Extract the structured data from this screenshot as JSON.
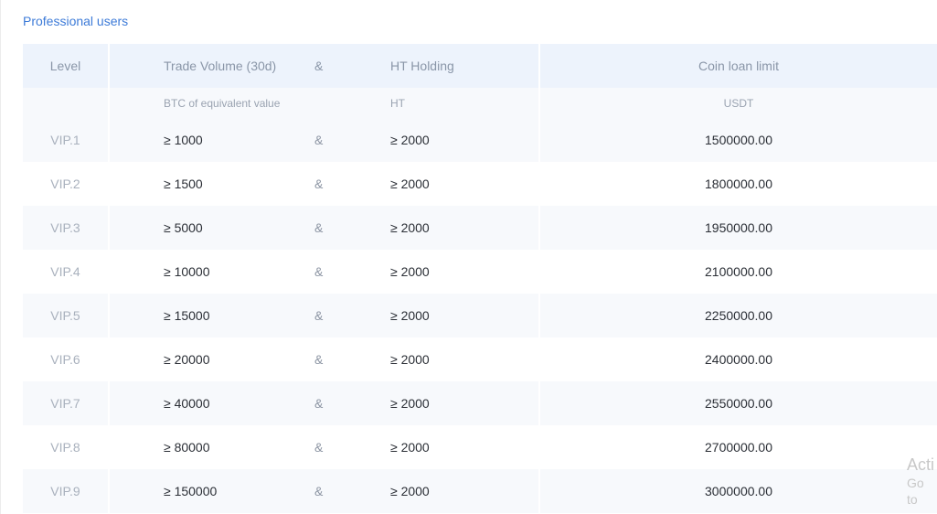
{
  "section": {
    "title": "Professional users"
  },
  "table": {
    "headers": {
      "level": "Level",
      "trade_volume": "Trade Volume (30d)",
      "amp": "&",
      "ht_holding": "HT Holding",
      "coin_loan_limit": "Coin loan limit"
    },
    "units": {
      "trade_volume": "BTC of equivalent value",
      "ht_holding": "HT",
      "coin_loan_limit": "USDT"
    },
    "rows": [
      {
        "level": "VIP.1",
        "trade": "≥ 1000",
        "amp": "&",
        "ht": "≥ 2000",
        "limit": "1500000.00"
      },
      {
        "level": "VIP.2",
        "trade": "≥ 1500",
        "amp": "&",
        "ht": "≥ 2000",
        "limit": "1800000.00"
      },
      {
        "level": "VIP.3",
        "trade": "≥ 5000",
        "amp": "&",
        "ht": "≥ 2000",
        "limit": "1950000.00"
      },
      {
        "level": "VIP.4",
        "trade": "≥ 10000",
        "amp": "&",
        "ht": "≥ 2000",
        "limit": "2100000.00"
      },
      {
        "level": "VIP.5",
        "trade": "≥ 15000",
        "amp": "&",
        "ht": "≥ 2000",
        "limit": "2250000.00"
      },
      {
        "level": "VIP.6",
        "trade": "≥ 20000",
        "amp": "&",
        "ht": "≥ 2000",
        "limit": "2400000.00"
      },
      {
        "level": "VIP.7",
        "trade": "≥ 40000",
        "amp": "&",
        "ht": "≥ 2000",
        "limit": "2550000.00"
      },
      {
        "level": "VIP.8",
        "trade": "≥ 80000",
        "amp": "&",
        "ht": "≥ 2000",
        "limit": "2700000.00"
      },
      {
        "level": "VIP.9",
        "trade": "≥ 150000",
        "amp": "&",
        "ht": "≥ 2000",
        "limit": "3000000.00"
      }
    ]
  },
  "watermark": {
    "line1": "Acti",
    "line2": "Go to"
  }
}
